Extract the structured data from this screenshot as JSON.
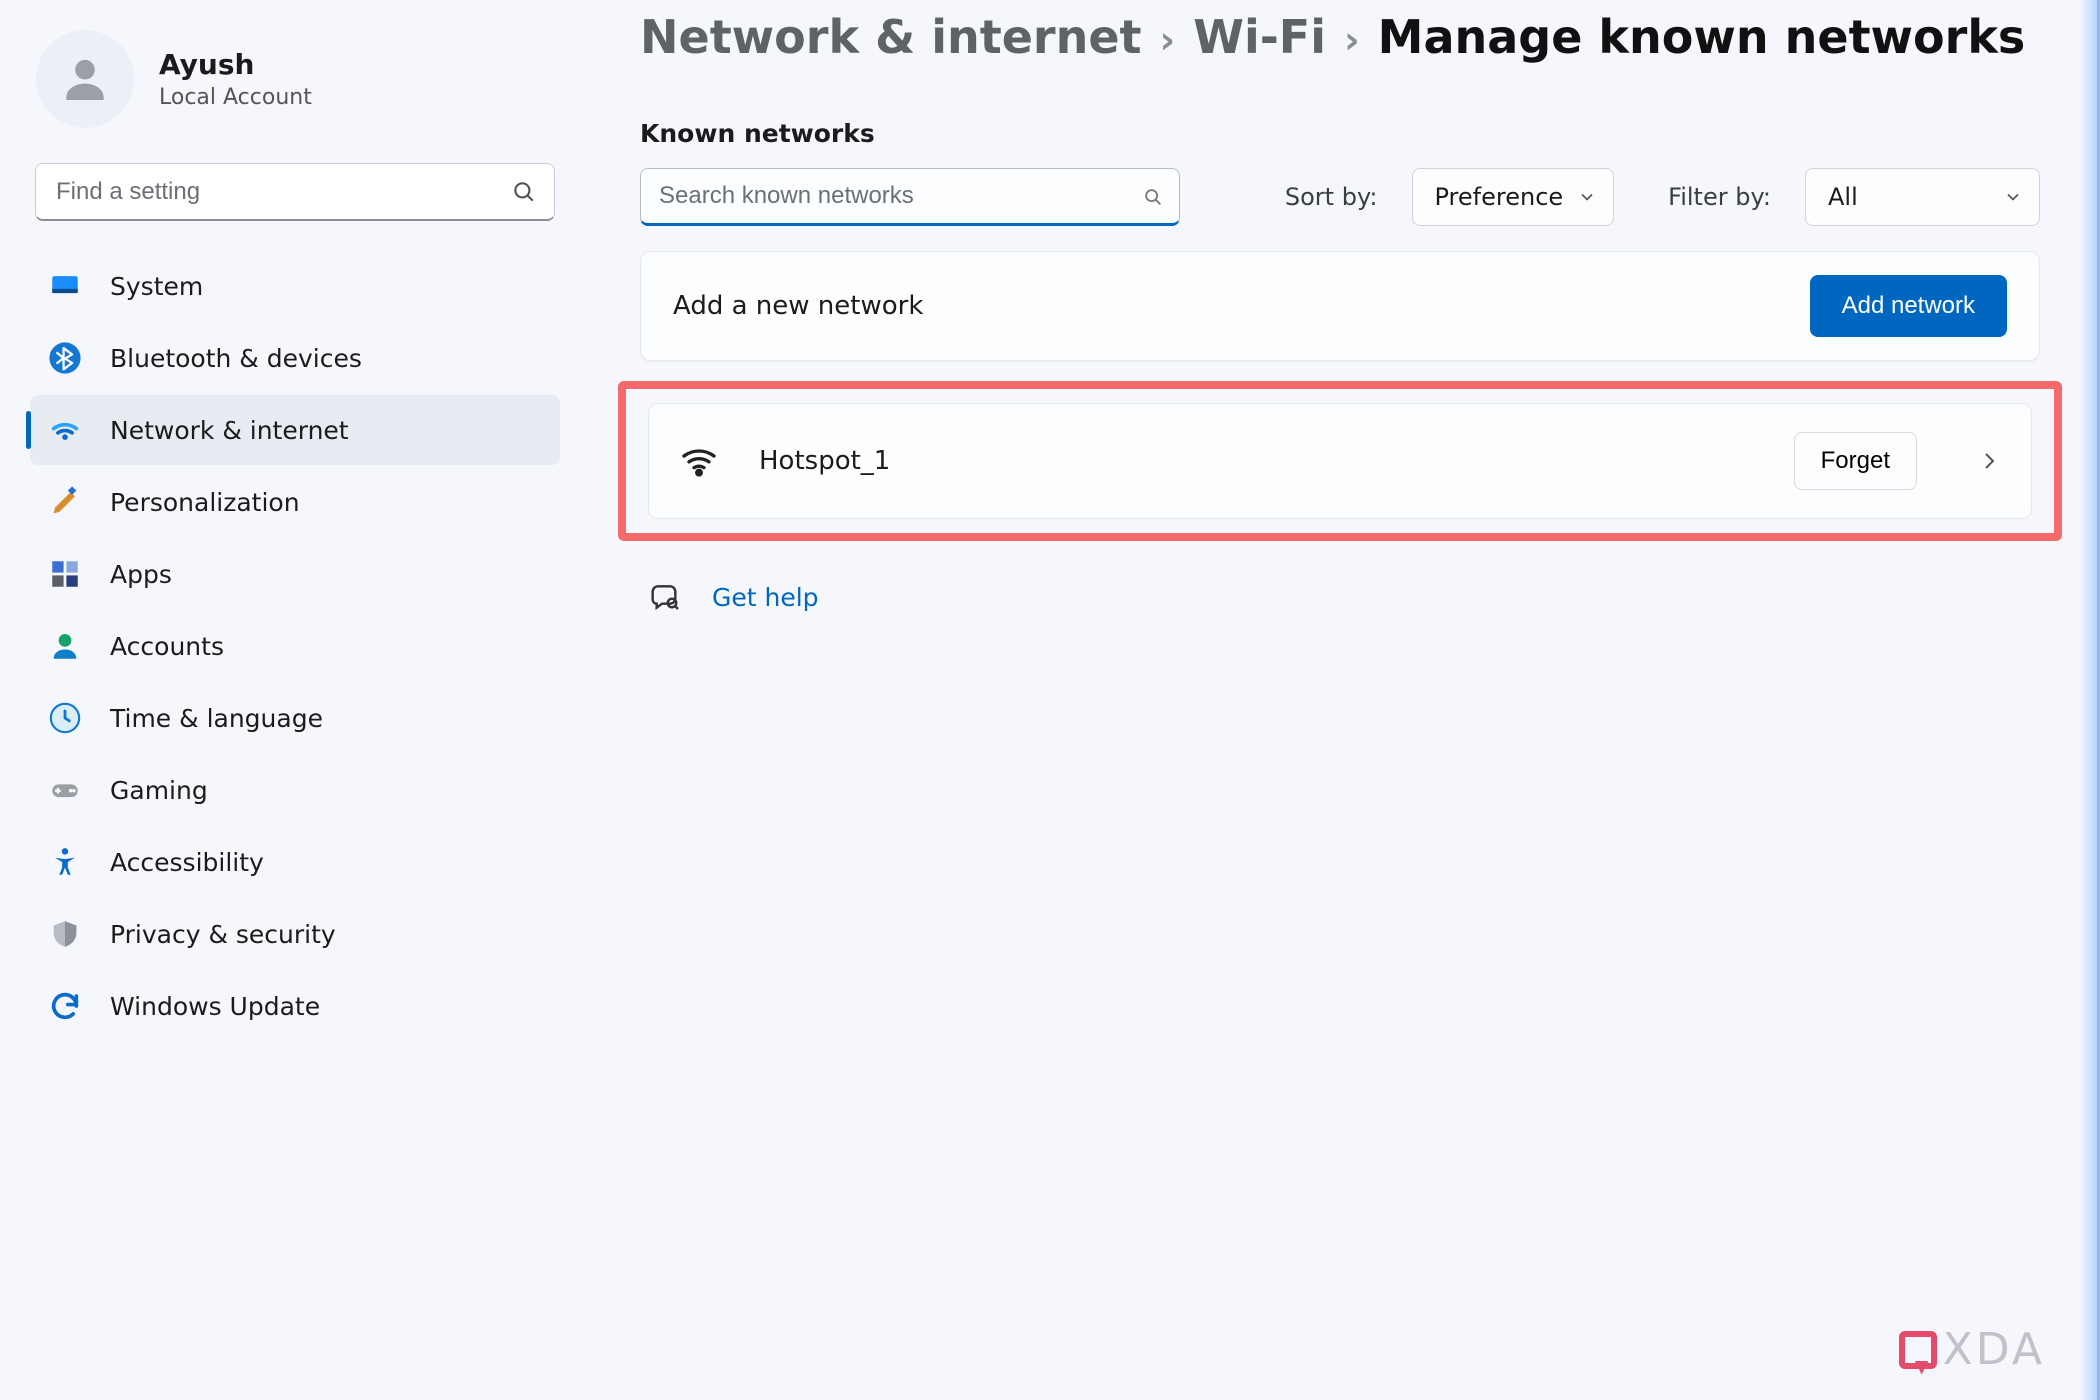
{
  "profile": {
    "name": "Ayush",
    "subtitle": "Local Account"
  },
  "sidebar_search": {
    "placeholder": "Find a setting"
  },
  "nav": {
    "system": {
      "label": "System"
    },
    "bluetooth": {
      "label": "Bluetooth & devices"
    },
    "network": {
      "label": "Network & internet"
    },
    "personalization": {
      "label": "Personalization"
    },
    "apps": {
      "label": "Apps"
    },
    "accounts": {
      "label": "Accounts"
    },
    "time": {
      "label": "Time & language"
    },
    "gaming": {
      "label": "Gaming"
    },
    "accessibility": {
      "label": "Accessibility"
    },
    "privacy": {
      "label": "Privacy & security"
    },
    "update": {
      "label": "Windows Update"
    }
  },
  "breadcrumb": {
    "root": "Network & internet",
    "mid": "Wi-Fi",
    "current": "Manage known networks"
  },
  "section_title": "Known networks",
  "search_networks": {
    "placeholder": "Search known networks"
  },
  "sort": {
    "label": "Sort by:",
    "value": "Preference"
  },
  "filter": {
    "label": "Filter by:",
    "value": "All"
  },
  "add_card": {
    "title": "Add a new network",
    "button": "Add network"
  },
  "network_row": {
    "name": "Hotspot_1",
    "forget": "Forget"
  },
  "help": {
    "label": "Get help"
  },
  "watermark": "XDA"
}
